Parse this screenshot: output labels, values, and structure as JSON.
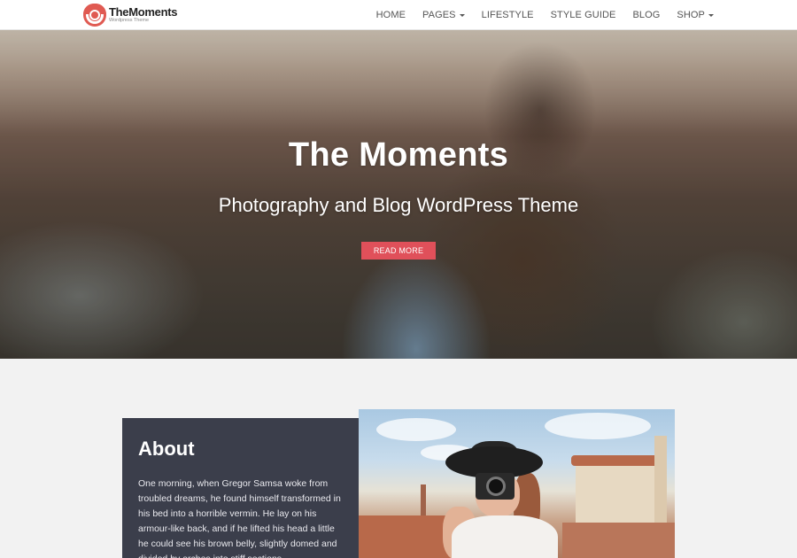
{
  "brand": {
    "name": "TheMoments",
    "tagline": "Wordpress Theme",
    "accent_color": "#e0505a"
  },
  "nav": {
    "items": [
      {
        "label": "HOME",
        "dropdown": false
      },
      {
        "label": "PAGES",
        "dropdown": true
      },
      {
        "label": "LIFESTYLE",
        "dropdown": false
      },
      {
        "label": "STYLE GUIDE",
        "dropdown": false
      },
      {
        "label": "BLOG",
        "dropdown": false
      },
      {
        "label": "SHOP",
        "dropdown": true
      }
    ]
  },
  "hero": {
    "title": "The Moments",
    "subtitle": "Photography and Blog WordPress Theme",
    "button_label": "READ MORE"
  },
  "about": {
    "title": "About",
    "text": "One morning, when Gregor Samsa woke from troubled dreams, he found himself transformed in his bed into a horrible vermin. He lay on his armour-like back, and if he lifted his head a little he could see his brown belly, slightly domed and divided by arches into stiff sections.",
    "panel_color": "#3b3e4b"
  }
}
